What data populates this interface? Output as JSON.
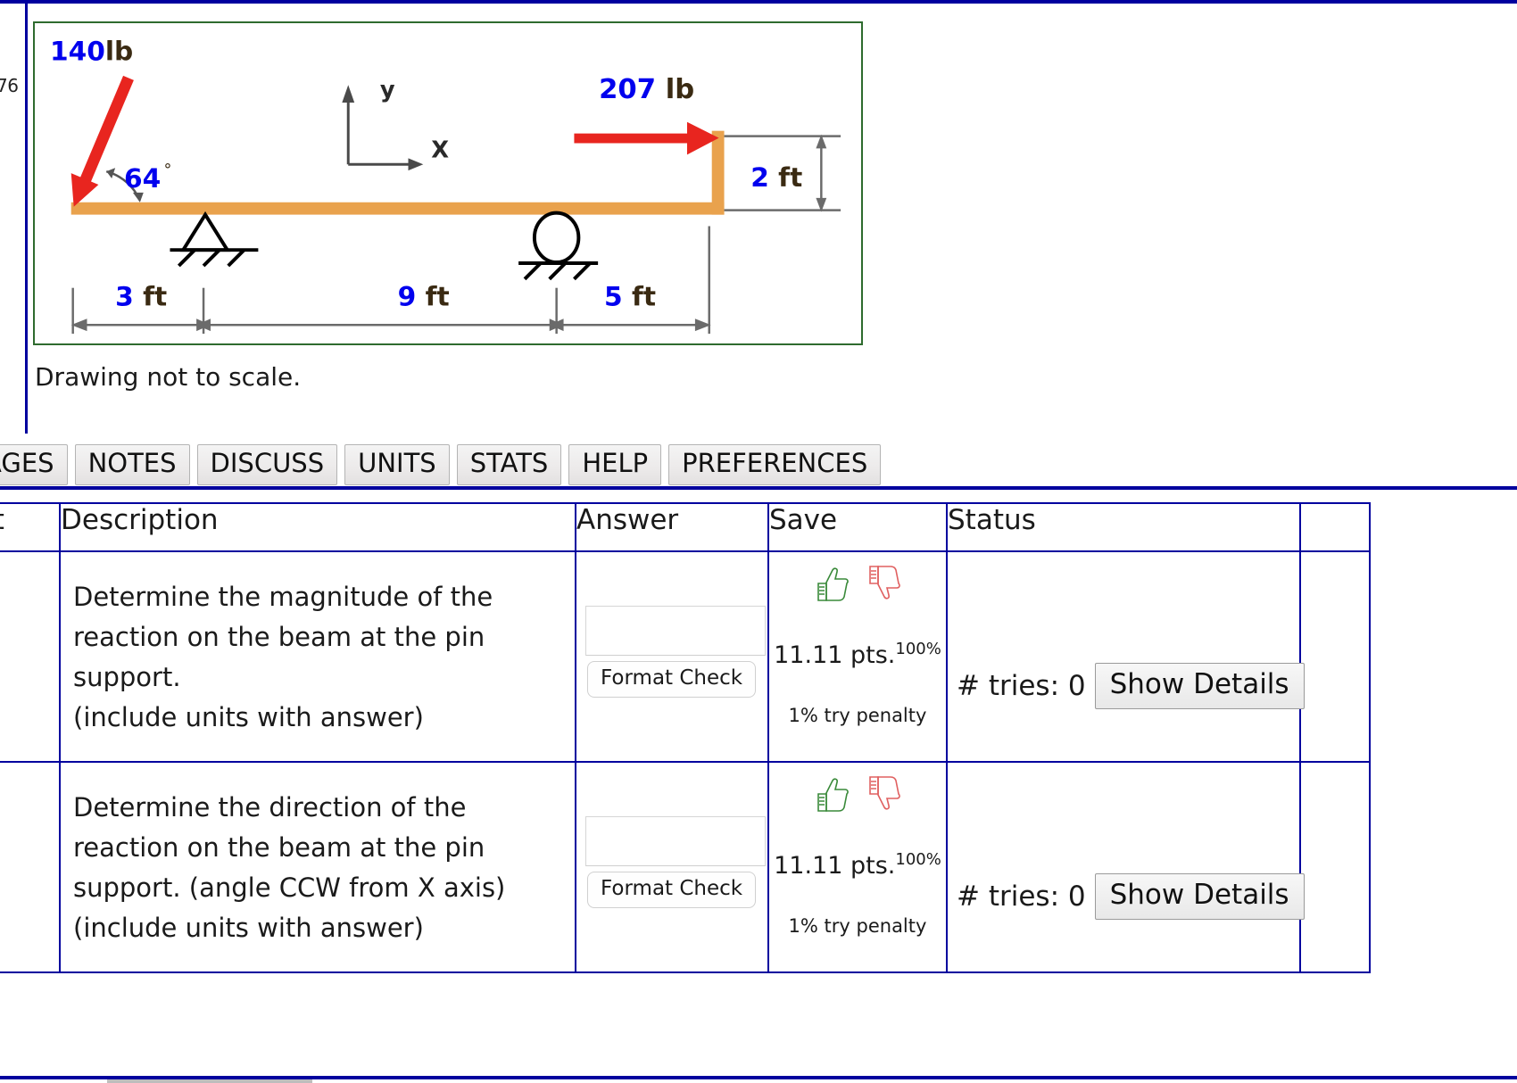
{
  "page": {
    "clipped_page_marker": "76",
    "caption": "Drawing not to scale."
  },
  "figure": {
    "alt_name": "beam-free-body-diagram",
    "applied_load_1": {
      "value": "140",
      "unit": "lb",
      "label": "140lb"
    },
    "angle": {
      "value": "64",
      "symbol": "°",
      "label": "64"
    },
    "applied_load_2": {
      "value": "207",
      "unit": "lb",
      "label": "207 lb"
    },
    "axis_y_label": "y",
    "axis_x_label": "X",
    "vertical_dimension": "2 ft",
    "horizontal_dimensions": [
      "3 ft",
      "9 ft",
      "5 ft"
    ],
    "colors": {
      "beam": "#e8a košice",
      "beam_hex": "#e9a24d",
      "load_arrow": "#e8251f",
      "label_blue": "#0000ee",
      "border_green": "#2e6b2e"
    }
  },
  "tabs": [
    {
      "label": "MAGES",
      "name": "tab-images"
    },
    {
      "label": "NOTES",
      "name": "tab-notes"
    },
    {
      "label": "DISCUSS",
      "name": "tab-discuss"
    },
    {
      "label": "UNITS",
      "name": "tab-units"
    },
    {
      "label": "STATS",
      "name": "tab-stats"
    },
    {
      "label": "HELP",
      "name": "tab-help"
    },
    {
      "label": "PREFERENCES",
      "name": "tab-preferences"
    }
  ],
  "table": {
    "headers": {
      "part": "rt",
      "description": "Description",
      "answer": "Answer",
      "save": "Save",
      "status": "Status"
    },
    "rows": [
      {
        "description_lines": [
          "Determine the magnitude of the",
          "reaction on the beam at the pin",
          "support.",
          "(include units with answer)"
        ],
        "answer_value": "",
        "answer_placeholder": "",
        "format_check_label": "Format Check",
        "points": "11.11 pts.",
        "points_percent": "100%",
        "penalty": "1% try penalty",
        "tries": "# tries: 0",
        "show_details_label": "Show Details",
        "thumb_up_icon": "thumbs-up-icon",
        "thumb_down_icon": "thumbs-down-icon"
      },
      {
        "description_lines": [
          "Determine the direction of the",
          "reaction on the beam at the pin",
          "support. (angle CCW from X axis)",
          "(include units with answer)"
        ],
        "answer_value": "",
        "answer_placeholder": "",
        "format_check_label": "Format Check",
        "points": "11.11 pts.",
        "points_percent": "100%",
        "penalty": "1% try penalty",
        "tries": "# tries: 0",
        "show_details_label": "Show Details",
        "thumb_up_icon": "thumbs-up-icon",
        "thumb_down_icon": "thumbs-down-icon"
      }
    ]
  }
}
